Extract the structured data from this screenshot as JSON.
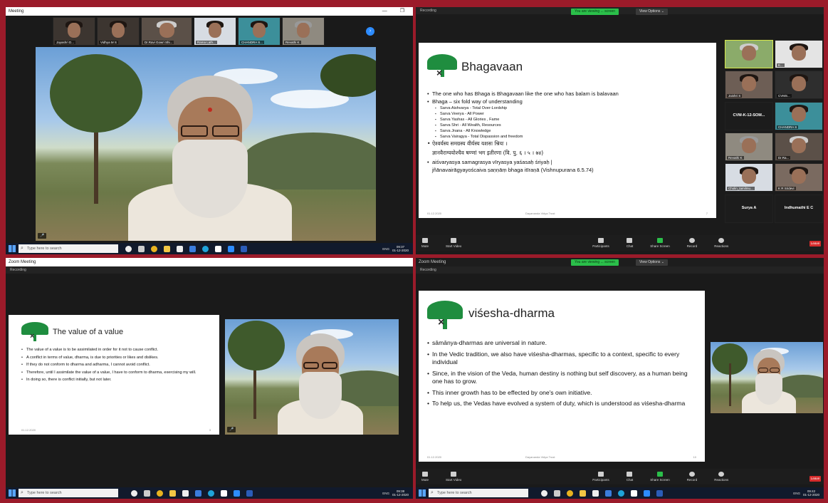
{
  "q1": {
    "title": "Meeting",
    "controls": "—  ❐",
    "thumbnails": [
      {
        "name": "Jayashri D...",
        "icon": "microphone-muted-icon"
      },
      {
        "name": "Vidhya M S",
        "icon": "microphone-muted-icon"
      },
      {
        "name": "Dr.Ravi Gowri Shi...",
        "icon": "microphone-muted-icon"
      },
      {
        "name": "Rama Lath...",
        "icon": "microphone-muted-icon"
      },
      {
        "name": "CHANDRA S...",
        "icon": "microphone-muted-icon"
      },
      {
        "name": "Revathi K",
        "icon": "microphone-muted-icon"
      }
    ],
    "video_badge": "🎤"
  },
  "q2": {
    "recording": "Recording",
    "share_status": "You are viewing ... screen",
    "view_options": "View Options ⌄",
    "slide": {
      "title": "Bhagavaan",
      "bullets": [
        {
          "text": "The one who has Bhaga is Bhagavaan like the one who has balam is balavaan",
          "level": 0
        },
        {
          "text": "Bhaga – six fold way of understanding",
          "level": 0
        },
        {
          "text": "Sarva Aishvarya - Total Over-Lordship",
          "level": 1
        },
        {
          "text": "Sarva Veerya - All Power",
          "level": 1
        },
        {
          "text": "Sarva Yashas - All Glories , Fame",
          "level": 1
        },
        {
          "text": "Sarva Shri - All Wealth, Resources",
          "level": 1
        },
        {
          "text": "Sarva Jnana - All Knowledge",
          "level": 1
        },
        {
          "text": "Sarva Vairagya - Total Dispassion and freedom",
          "level": 1
        },
        {
          "text": "ऐश्वर्यस्य समग्रस्य वीर्यस्य यशसः श्रियः ।",
          "level": 0
        },
        {
          "text": "ज्ञानवैराग्ययोश्चैव षण्णां भग इतीरणा (वि. पु. ६ । ५ । ७४)",
          "level": 2
        },
        {
          "text": "aiśvaryasya samagrasya vīryasya yaśasaḥ śriyaḥ |",
          "level": 0
        },
        {
          "text": "jñānavairāgyayoścaiva ṣaṇṇāṃ bhaga itīraṇā (Vishnupurana 6.5.74)",
          "level": 2
        }
      ],
      "footer_left": "01.12.2020",
      "footer_mid": "Dayananda Vidya Trust",
      "footer_right": "7"
    },
    "gallery": [
      {
        "name": "",
        "type": "video"
      },
      {
        "name": "K...",
        "type": "video"
      },
      {
        "name": "Jaishri S",
        "type": "video"
      },
      {
        "name": "CVMS...",
        "type": "video"
      },
      {
        "name": "CVM-K-12-SOM...",
        "type": "blank"
      },
      {
        "name": "CHANDRA S",
        "type": "video"
      },
      {
        "name": "Revathi K",
        "type": "video"
      },
      {
        "name": "Dr.Ra...",
        "type": "video"
      },
      {
        "name": "Cholin_tamilmu...",
        "type": "video"
      },
      {
        "name": "K R Sridevi",
        "type": "video"
      },
      {
        "name": "Surya A",
        "type": "blank"
      },
      {
        "name": "Indhumathi E C",
        "type": "blank"
      }
    ],
    "toolbar": [
      "Mute",
      "Start Video",
      "Participants",
      "Chat",
      "Share Screen",
      "Record",
      "Reactions"
    ],
    "participants_count": "25",
    "end_label": "Leave"
  },
  "q3": {
    "title": "Zoom Meeting",
    "recording": "Recording",
    "slide": {
      "title": "The value of a value",
      "bullets": [
        "The value of a value is to be assimilated in order for it not to cause conflict.",
        "A conflict in terms of value, dharma, is due to priorities or likes and dislikes.",
        "If they do not conform to dharma and adharma, I cannot avoid conflict.",
        "Therefore, until I assimilate the value of a value, I have to conform to dharma, exercising my will.",
        "In doing so, there is conflict initially, but not later."
      ],
      "footer_left": "01.12.2020",
      "footer_right": "3"
    }
  },
  "q4": {
    "title": "Zoom Meeting",
    "recording": "Recording",
    "share_status": "You are viewing ... screen",
    "view_options": "View Options ⌄",
    "slide": {
      "title": "viśesha-dharma",
      "bullets": [
        "sāmānya-dharmas are universal in nature.",
        "In the Vedic tradition, we also have viśesha-dharmas, specific to a context, specific to every individual",
        "Since, in the vision of the Veda, human destiny is nothing but self discovery, as a human being one has to grow.",
        "This inner growth has to be effected by one's own initiative.",
        "To help us, the Vedas have evolved a system of duty, which is understood as viśesha-dharma"
      ],
      "footer_left": "01.12.2020",
      "footer_mid": "Dayananda Vidya Trust",
      "footer_right": "10"
    },
    "toolbar": [
      "Mute",
      "Start Video",
      "Participants",
      "Chat",
      "Share Screen",
      "Record",
      "Reactions"
    ],
    "participants_count": "25",
    "end_label": "Leave"
  },
  "taskbar": {
    "search_placeholder": "Type here to search",
    "lang": "ENG",
    "time_q1": "09:37",
    "date": "01-12-2020",
    "time_q3": "09:38",
    "time_q4": "09:42"
  },
  "colors": {
    "frame": "#9b1b2a",
    "zoom_green": "#2bbf4a",
    "logo_green": "#1f8d3f",
    "end_red": "#d72c2c"
  }
}
